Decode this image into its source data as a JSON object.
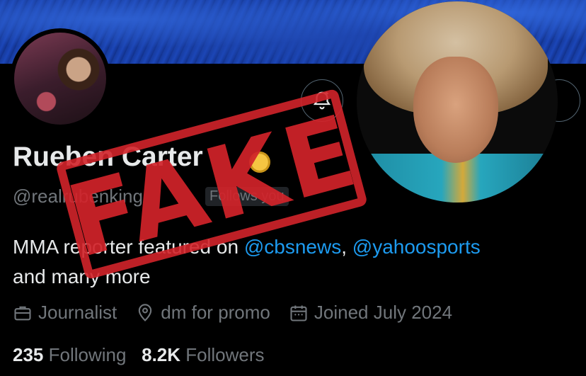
{
  "profile": {
    "name": "Rueben Carter",
    "handle": "@realrubenking",
    "follows_you": "Follows you",
    "bio_text_1": "MMA reporter featured on ",
    "bio_link_1": "@cbsnews",
    "bio_sep": ", ",
    "bio_link_2": "@yahoosports",
    "bio_text_2": "and many more",
    "category": "Journalist",
    "location": "dm for promo",
    "joined": "Joined July 2024",
    "following_count": "235",
    "following_label": "Following",
    "followers_count": "8.2K",
    "followers_label": "Followers"
  },
  "overlay": {
    "stamp_text": "FAKE",
    "stamp_color": "#d2232a"
  },
  "icons": {
    "notify": "bell-plus-icon",
    "category": "briefcase-icon",
    "location": "location-pin-icon",
    "joined": "calendar-icon",
    "verified": "verified-badge-icon"
  },
  "colors": {
    "background": "#000000",
    "text": "#e7e9ea",
    "muted": "#71767b",
    "link": "#1d9bf0"
  }
}
